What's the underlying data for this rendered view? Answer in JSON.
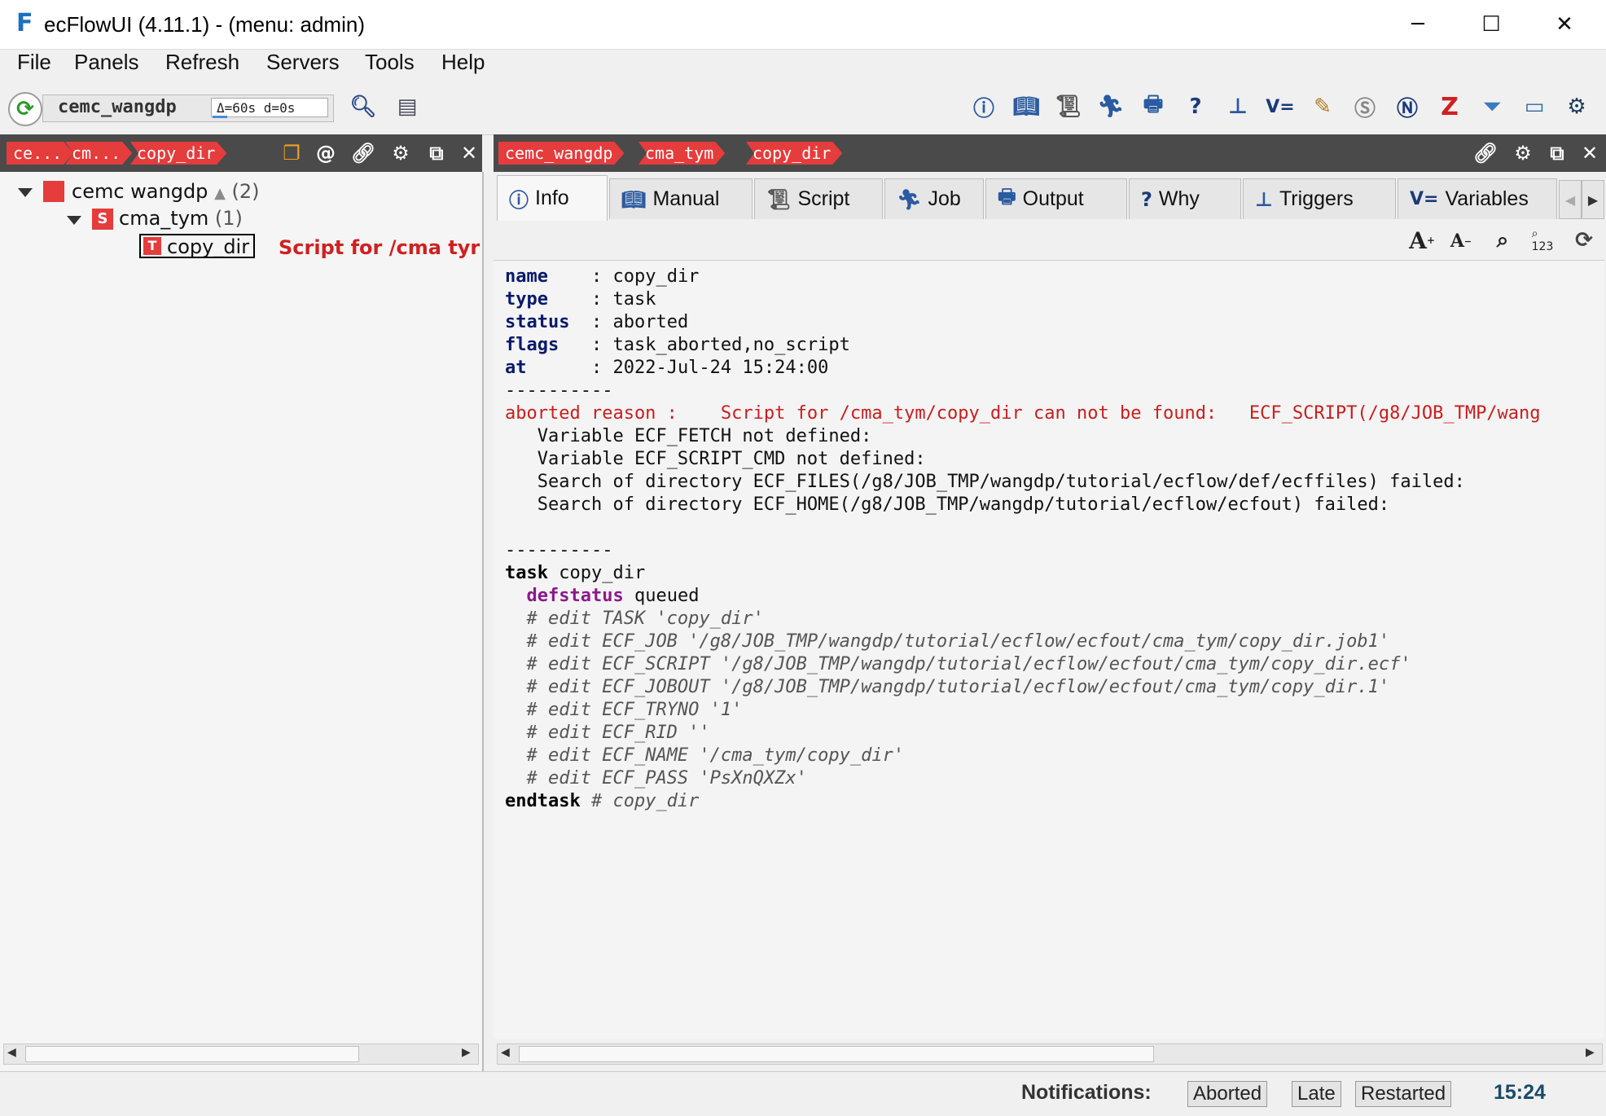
{
  "window": {
    "title": "ecFlowUI (4.11.1) - (menu: admin)",
    "logo": "F",
    "minimize": "─",
    "maximize": "☐",
    "close": "✕"
  },
  "menu": [
    "File",
    "Panels",
    "Refresh",
    "Servers",
    "Tools",
    "Help"
  ],
  "toolbar": {
    "server_name": "cemc_wangdp",
    "delta": "Δ=60s d=0s"
  },
  "left_panel": {
    "breadcrumbs": [
      "ce...",
      "cm...",
      "copy_dir"
    ],
    "tree": {
      "server": {
        "label": "cemc wangdp",
        "count": "(2)"
      },
      "suite": {
        "icon": "S",
        "label": "cma_tym",
        "count": "(1)"
      },
      "task": {
        "icon": "T",
        "label": "copy_dir",
        "message": "Script for /cma tyr"
      }
    }
  },
  "right_panel": {
    "breadcrumbs": [
      "cemc_wangdp",
      "cma_tym",
      "copy_dir"
    ],
    "tabs": [
      {
        "label": "Info",
        "icon": "info-icon",
        "glyph": "ⓘ"
      },
      {
        "label": "Manual",
        "icon": "manual-icon",
        "glyph": "📖"
      },
      {
        "label": "Script",
        "icon": "script-icon",
        "glyph": "📜"
      },
      {
        "label": "Job",
        "icon": "job-icon",
        "glyph": "🏃"
      },
      {
        "label": "Output",
        "icon": "output-icon",
        "glyph": "🖶"
      },
      {
        "label": "Why",
        "icon": "why-icon",
        "glyph": "?"
      },
      {
        "label": "Triggers",
        "icon": "triggers-icon",
        "glyph": "⊥"
      },
      {
        "label": "Variables",
        "icon": "variables-icon",
        "glyph": "V="
      }
    ],
    "info": {
      "name": "copy_dir",
      "type": "task",
      "status": "aborted",
      "flags": "task_aborted,no_script",
      "at": "2022-Jul-24 15:24:00",
      "separator": "----------",
      "aborted_reason_label": "aborted reason :",
      "aborted_reason": "Script for /cma_tym/copy_dir can not be found:   ECF_SCRIPT(/g8/JOB_TMP/wang",
      "reason_lines": [
        "Variable ECF_FETCH not defined:",
        "Variable ECF_SCRIPT_CMD not defined:",
        "Search of directory ECF_FILES(/g8/JOB_TMP/wangdp/tutorial/ecflow/def/ecffiles) failed:",
        "Search of directory ECF_HOME(/g8/JOB_TMP/wangdp/tutorial/ecflow/ecfout) failed:"
      ],
      "def_task_kw": "task",
      "def_task_name": "copy_dir",
      "defstatus_kw": "defstatus",
      "defstatus_val": "queued",
      "edits": [
        "# edit TASK 'copy_dir'",
        "# edit ECF_JOB '/g8/JOB_TMP/wangdp/tutorial/ecflow/ecfout/cma_tym/copy_dir.job1'",
        "# edit ECF_SCRIPT '/g8/JOB_TMP/wangdp/tutorial/ecflow/ecfout/cma_tym/copy_dir.ecf'",
        "# edit ECF_JOBOUT '/g8/JOB_TMP/wangdp/tutorial/ecflow/ecfout/cma_tym/copy_dir.1'",
        "# edit ECF_TRYNO '1'",
        "# edit ECF_RID ''",
        "# edit ECF_NAME '/cma_tym/copy_dir'",
        "# edit ECF_PASS 'PsXnQXZx'"
      ],
      "endtask_kw": "endtask",
      "endtask_comment": "# copy_dir"
    }
  },
  "status_bar": {
    "notifications_label": "Notifications:",
    "buttons": [
      "Aborted",
      "Late",
      "Restarted"
    ],
    "time": "15:24"
  },
  "colors": {
    "aborted_red": "#e53c3c",
    "header_dark": "#4a4a4a",
    "keyword_blue": "#0a1a6a",
    "defstatus_purple": "#8a1a8a"
  }
}
